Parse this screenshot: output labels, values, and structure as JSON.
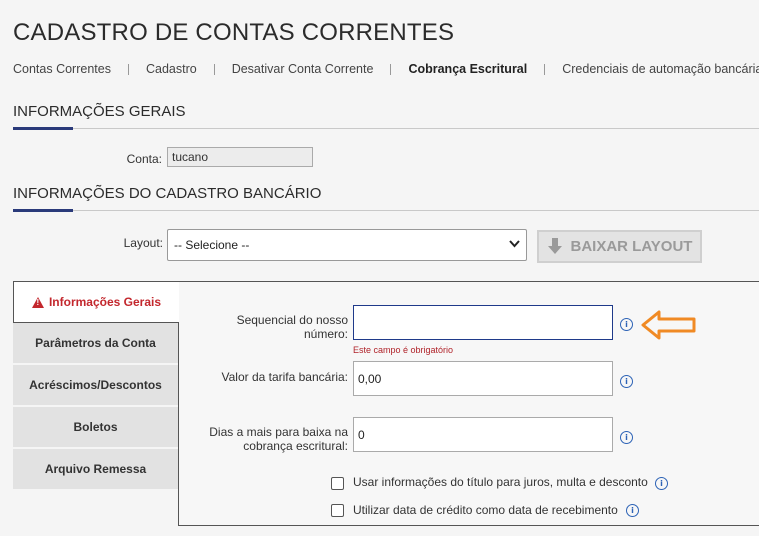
{
  "page": {
    "title": "CADASTRO DE CONTAS CORRENTES"
  },
  "nav": {
    "items": [
      {
        "label": "Contas Correntes"
      },
      {
        "label": "Cadastro"
      },
      {
        "label": "Desativar Conta Corrente"
      },
      {
        "label": "Cobrança Escritural",
        "active": true
      },
      {
        "label": "Credenciais de automação bancária"
      }
    ]
  },
  "section_general": {
    "title": "INFORMAÇÕES GERAIS",
    "conta_label": "Conta:",
    "conta_value": "tucano"
  },
  "section_bank": {
    "title": "INFORMAÇÕES DO CADASTRO BANCÁRIO",
    "layout_label": "Layout:",
    "layout_selected": "-- Selecione --",
    "download_button": "BAIXAR LAYOUT"
  },
  "side_tabs": [
    {
      "label": "Informações Gerais",
      "active": true,
      "has_error": true
    },
    {
      "label": "Parâmetros da Conta"
    },
    {
      "label": "Acréscimos/Descontos"
    },
    {
      "label": "Boletos"
    },
    {
      "label": "Arquivo Remessa"
    }
  ],
  "form": {
    "nosso_numero_label_1": "Sequencial do nosso",
    "nosso_numero_label_2": "número:",
    "nosso_numero_value": "",
    "nosso_numero_error": "Este campo é obrigatório",
    "tarifa_label": "Valor da tarifa bancária:",
    "tarifa_value": "0,00",
    "dias_label_1": "Dias a mais para baixa na",
    "dias_label_2": "cobrança escritural:",
    "dias_value": "0",
    "check_juros_label": "Usar informações do título para juros, multa e desconto",
    "check_credito_label": "Utilizar data de crédito como data de recebimento"
  },
  "colors": {
    "accent": "#2a3a7a",
    "error": "#c3272d",
    "arrow": "#f08a24",
    "info": "#2d63b6"
  },
  "icons": {
    "warning": "warning-icon",
    "info": "info-icon",
    "download": "download-icon",
    "pointer": "arrow-left-icon"
  }
}
